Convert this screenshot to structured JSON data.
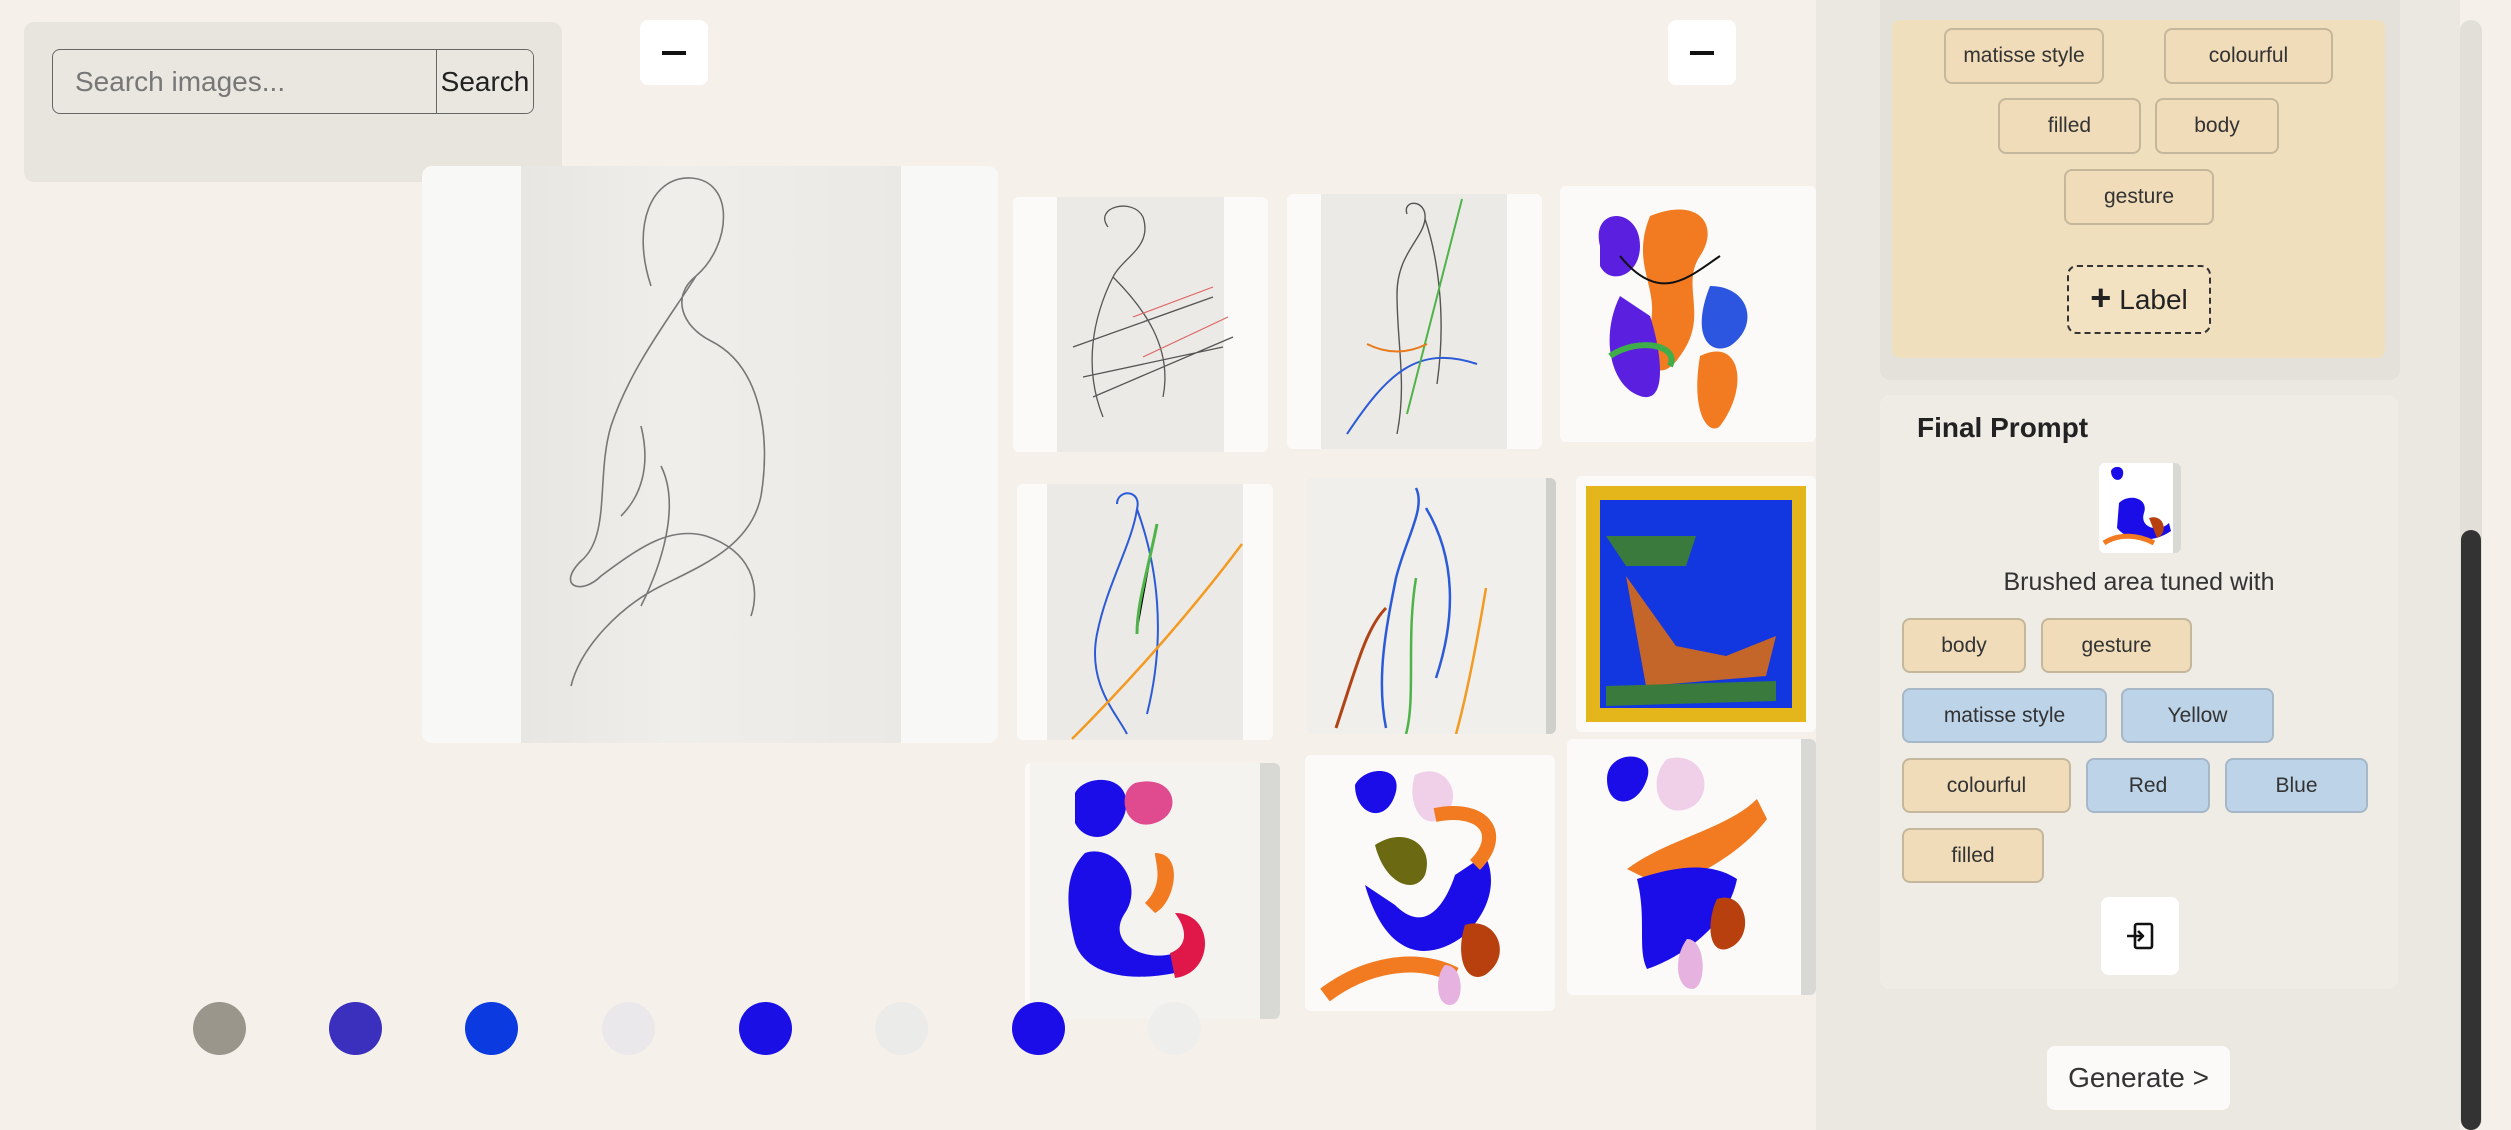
{
  "search": {
    "placeholder": "Search images...",
    "button_label": "Search"
  },
  "toolbar": {
    "minimize_icon": "minus-icon"
  },
  "palette": {
    "swatches": [
      "#9a968c",
      "#3b2fbd",
      "#0b3be0",
      "#ebe8ec",
      "#1a10e6",
      "#ebebe9",
      "#1b0de8",
      "#eeeeed"
    ]
  },
  "labels": {
    "items": [
      "matisse style",
      "colourful",
      "filled",
      "body",
      "gesture"
    ],
    "add_label": "Label"
  },
  "final_prompt": {
    "title": "Final Prompt",
    "text": "Brushed area tuned with",
    "chips": [
      {
        "label": "body",
        "kind": "tag"
      },
      {
        "label": "gesture",
        "kind": "tag"
      },
      {
        "label": "matisse style",
        "kind": "color"
      },
      {
        "label": "Yellow",
        "kind": "color"
      },
      {
        "label": "colourful",
        "kind": "tag"
      },
      {
        "label": "Red",
        "kind": "color"
      },
      {
        "label": "Blue",
        "kind": "color"
      },
      {
        "label": "filled",
        "kind": "tag"
      }
    ],
    "export_icon": "export-icon"
  },
  "generate": {
    "label": "Generate >"
  },
  "colors": {
    "tag_chip": "#f0dcb8",
    "color_chip": "#bcd3e8",
    "labels_card": "#f0dfbd"
  }
}
